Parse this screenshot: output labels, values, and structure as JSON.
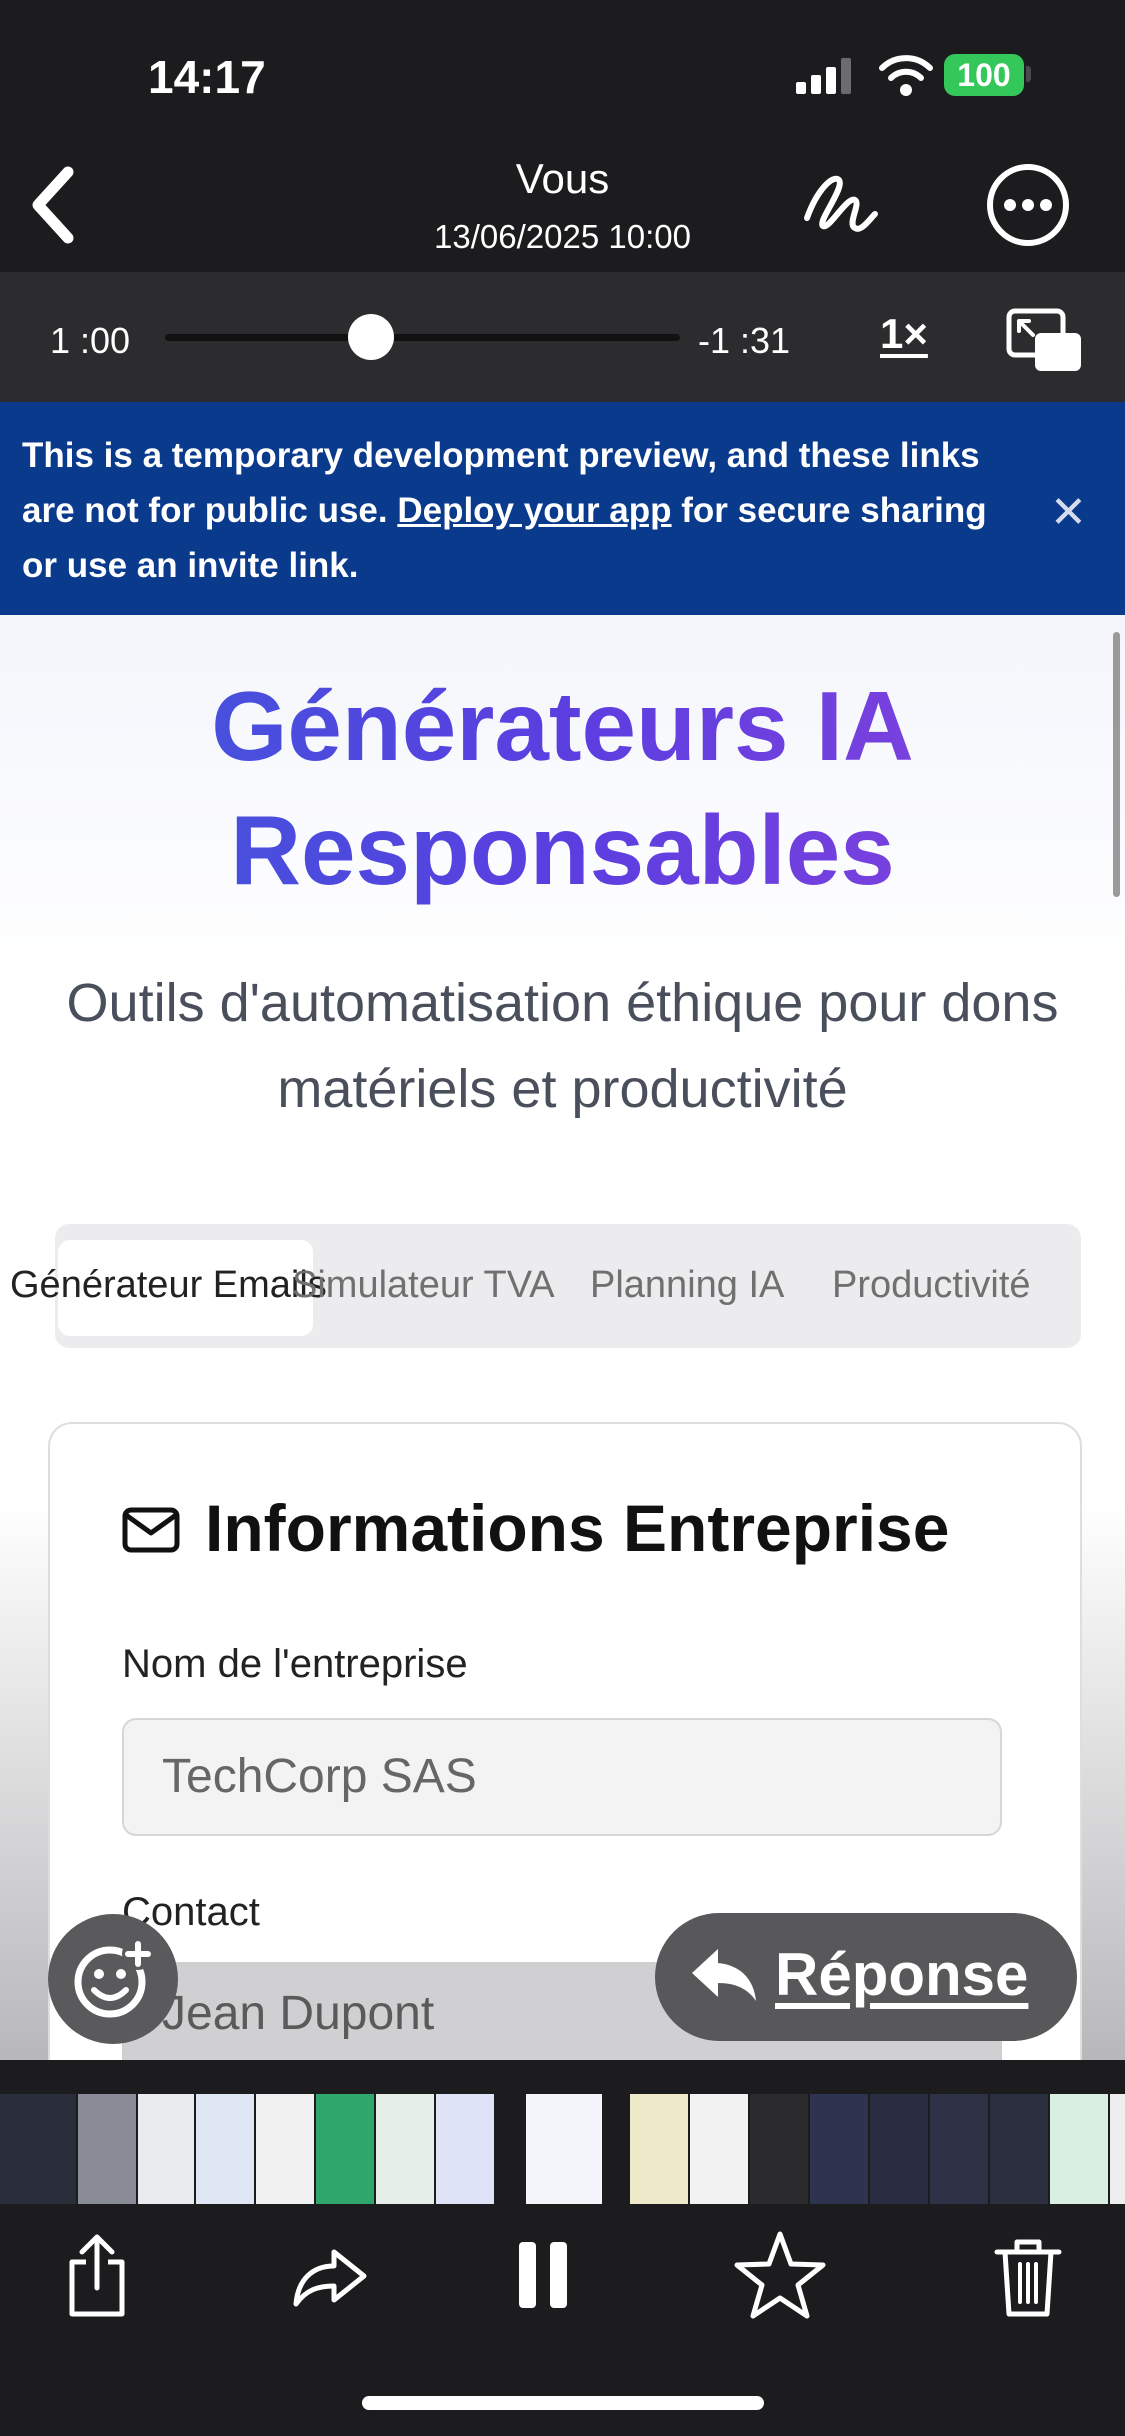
{
  "status_bar": {
    "time": "14:17",
    "battery": "100"
  },
  "nav": {
    "title": "Vous",
    "subtitle": "13/06/2025 10:00"
  },
  "playback": {
    "elapsed": "1 :00",
    "remaining": "-1 :31",
    "speed": "1×",
    "progress": 0.4
  },
  "banner": {
    "text_before": "This is a temporary development preview, and these links are not for public use. ",
    "link": "Deploy your app",
    "text_after": " for secure sharing or use an invite link."
  },
  "page": {
    "title_line1": "Générateurs IA",
    "title_line2": "Responsables",
    "subtitle": "Outils d'automatisation éthique pour dons matériels et productivité",
    "tabs": [
      "Générateur Emails",
      "Simulateur TVA",
      "Planning IA",
      "Productivité"
    ],
    "card": {
      "title": "Informations Entreprise",
      "company_label": "Nom de l'entreprise",
      "company_value": "TechCorp SAS",
      "contact_label": "Contact",
      "contact_value": "Jean Dupont"
    }
  },
  "reply": {
    "label": "Réponse"
  },
  "colors": {
    "banner": "#0a3a8c",
    "title_start": "#3b5bdb",
    "title_end": "#8b42dd",
    "battery": "#34c759"
  },
  "icons": [
    "back-chevron-icon",
    "markup-icon",
    "more-icon",
    "pip-icon",
    "close-icon",
    "mail-icon",
    "emoji-add-icon",
    "reply-arrow-icon",
    "share-icon",
    "forward-icon",
    "pause-icon",
    "star-icon",
    "trash-icon"
  ]
}
